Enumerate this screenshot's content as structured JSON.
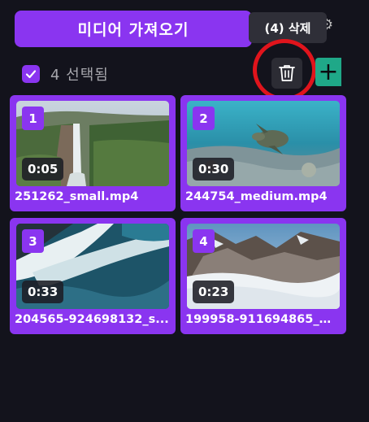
{
  "header": {
    "import_label": "미디어 가져오기",
    "tooltip": "(4) 삭제"
  },
  "selection": {
    "count_label": "4 선택됨"
  },
  "colors": {
    "accent": "#8a35f0",
    "add": "#1fa888",
    "highlight": "#e0141c"
  },
  "icons": {
    "settings": "gear-icon",
    "delete": "trash-icon",
    "add": "plus-icon",
    "check": "checkmark-icon"
  },
  "media": [
    {
      "index": "1",
      "duration": "0:05",
      "filename": "251262_small.mp4",
      "scene": "waterfall"
    },
    {
      "index": "2",
      "duration": "0:30",
      "filename": "244754_medium.mp4",
      "scene": "underwater-turtle"
    },
    {
      "index": "3",
      "duration": "0:33",
      "filename": "204565-924698132_s...",
      "scene": "ocean-waves"
    },
    {
      "index": "4",
      "duration": "0:23",
      "filename": "199958-911694865_m...",
      "scene": "snowy-mountains"
    }
  ]
}
